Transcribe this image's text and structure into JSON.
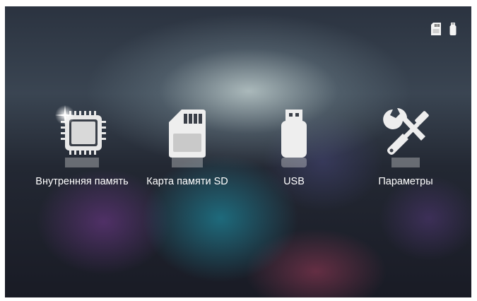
{
  "status_icons": [
    "sd-card-icon",
    "usb-icon"
  ],
  "menu": {
    "items": [
      {
        "label": "Внутренняя память",
        "icon": "memory-chip-icon"
      },
      {
        "label": "Карта памяти SD",
        "icon": "sd-card-icon"
      },
      {
        "label": "USB",
        "icon": "usb-drive-icon"
      },
      {
        "label": "Параметры",
        "icon": "settings-tools-icon"
      }
    ]
  }
}
